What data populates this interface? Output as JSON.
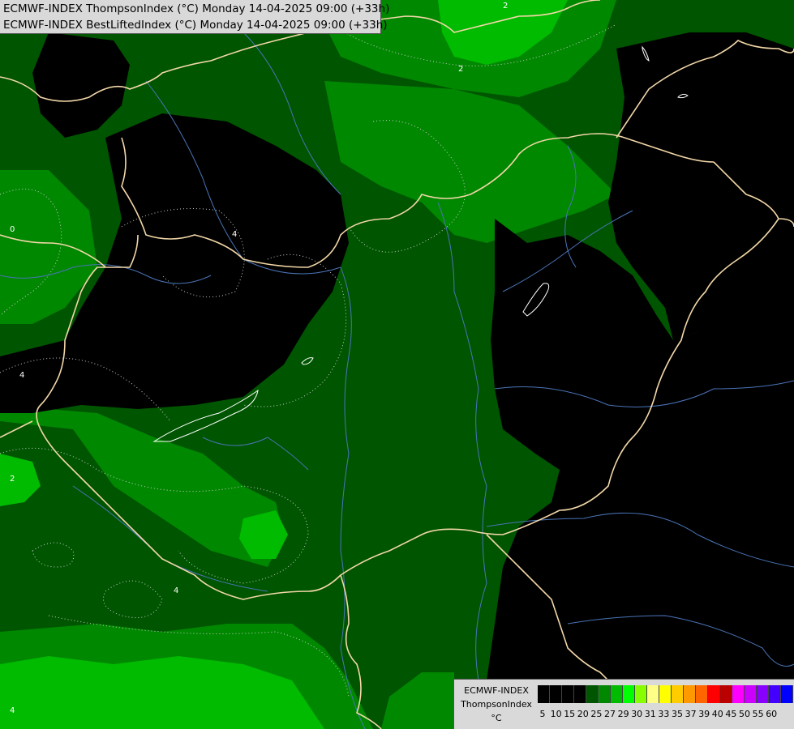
{
  "header": {
    "line1": "ECMWF-INDEX ThompsonIndex (°C) Monday 14-04-2025 09:00 (+33h)",
    "line2": "ECMWF-INDEX BestLiftedIndex (°C) Monday 14-04-2025 09:00 (+33h)"
  },
  "legend": {
    "line1": "ECMWF-INDEX",
    "line2": "ThompsonIndex",
    "unit": "°C",
    "colors": [
      "#000000",
      "#000000",
      "#000000",
      "#000000",
      "#005500",
      "#008800",
      "#00bb00",
      "#00ff00",
      "#88ff00",
      "#ffff88",
      "#ffff00",
      "#ffcc00",
      "#ff9900",
      "#ff6600",
      "#ff0000",
      "#bb0000",
      "#ff00ff",
      "#cc00ff",
      "#8800ff",
      "#4400ff",
      "#0000ff"
    ],
    "ticks": [
      "5",
      "10",
      "15",
      "20",
      "25",
      "27",
      "29",
      "30",
      "31",
      "33",
      "35",
      "37",
      "39",
      "40",
      "45",
      "50",
      "55",
      "60"
    ]
  },
  "contour_labels": [
    "2",
    "2",
    "0",
    "4",
    "4",
    "2",
    "4",
    "4"
  ]
}
